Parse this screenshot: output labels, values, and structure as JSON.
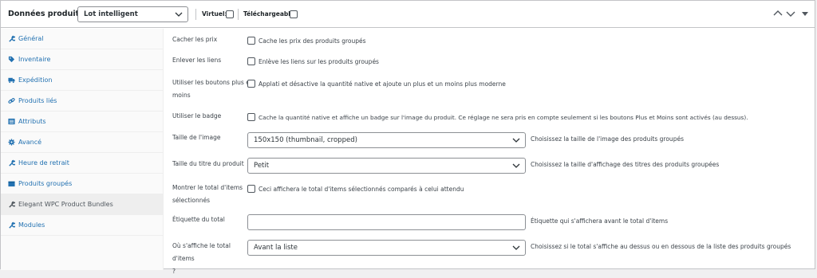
{
  "header": {
    "title": "Données produit —",
    "product_type": "Lot intelligent",
    "virtual_label": "Virtuel:",
    "downloadable_label": "Téléchargeable:"
  },
  "sidebar": {
    "items": [
      {
        "label": "Général",
        "icon": "wrench-icon"
      },
      {
        "label": "Inventaire",
        "icon": "tag-icon"
      },
      {
        "label": "Expédition",
        "icon": "truck-icon"
      },
      {
        "label": "Produits liés",
        "icon": "link-icon"
      },
      {
        "label": "Attributs",
        "icon": "list-icon"
      },
      {
        "label": "Avancé",
        "icon": "gear-icon"
      },
      {
        "label": "Heure de retrait",
        "icon": "wrench-icon"
      },
      {
        "label": "Produits groupés",
        "icon": "box-icon"
      },
      {
        "label": "Elegant WPC Product Bundles",
        "icon": "wrench-icon"
      },
      {
        "label": "Modules",
        "icon": "wrench-icon"
      }
    ]
  },
  "settings": {
    "hide_prices": {
      "label": "Cacher les prix",
      "text": "Cache les prix des produits groupés"
    },
    "remove_links": {
      "label": "Enlever les liens",
      "text": "Enlève les liens sur les produits groupés"
    },
    "plus_minus": {
      "label_1": "Utiliser les boutons plus et",
      "label_2": "moins",
      "text": "Applati et désactive la quantité native et ajoute un plus et un moins plus moderne"
    },
    "badge": {
      "label": "Utiliser le badge",
      "text": "Cache la quantité native et affiche un badge sur l'image du produit. Ce réglage ne sera pris en compte seulement si les boutons Plus et Moins sont activés (au dessus)."
    },
    "image_size": {
      "label": "Taille de l'image",
      "value": "150x150 (thumbnail, cropped)",
      "desc": "Choisissez la taille de l'image des produits groupés"
    },
    "title_size": {
      "label": "Taille du titre du produit",
      "value": "Petit",
      "desc": "Choisissez la taille d'affichage des titres des produits groupées"
    },
    "show_total": {
      "label_1": "Montrer le total d'items",
      "label_2": "sélectionnés",
      "text": "Ceci affichera le total d'items sélectionnés comparés à celui attendu"
    },
    "total_label": {
      "label": "Étiquette du total",
      "value": "",
      "desc": "Étiquette qui s'affichera avant le total d'items"
    },
    "total_position": {
      "label_1": "Où s'affiche le total d'items",
      "label_2": "?",
      "value": "Avant la liste",
      "desc": "Choisissez si le total s'affiche au dessus ou en dessous de la liste des produits groupés"
    }
  },
  "colors": {
    "link": "#2271b1",
    "border": "#c3c4c7",
    "text": "#3c434a"
  }
}
